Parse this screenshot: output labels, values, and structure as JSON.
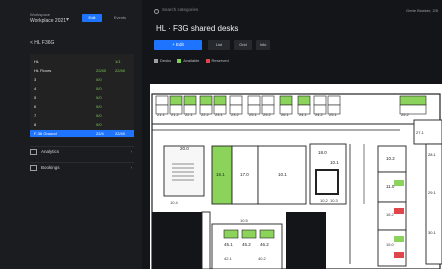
{
  "sidebar": {
    "title": "Workspace",
    "subtitle": "Workplace 2021",
    "tabs": [
      {
        "label": "Edit"
      },
      {
        "label": "Events"
      }
    ],
    "back": "< HL F36G",
    "rows": [
      {
        "name": "HL",
        "v1": "",
        "v2": "1/1"
      },
      {
        "name": "HL Floors",
        "v1": "22/40",
        "v2": "22/40"
      },
      {
        "name": "3",
        "v1": "0/0",
        "v2": ""
      },
      {
        "name": "4",
        "v1": "0/0",
        "v2": ""
      },
      {
        "name": "5",
        "v1": "0/0",
        "v2": ""
      },
      {
        "name": "6",
        "v1": "0/0",
        "v2": ""
      },
      {
        "name": "7",
        "v1": "0/0",
        "v2": ""
      },
      {
        "name": "8",
        "v1": "0/0",
        "v2": ""
      },
      {
        "name": "F-36 Ground",
        "v1": "22/4",
        "v2": "22/40",
        "selected": true
      }
    ],
    "sections": [
      {
        "label": "Analytics"
      },
      {
        "label": "Bookings"
      }
    ]
  },
  "main": {
    "search_placeholder": "Search categories",
    "user": "Grete Bowker, 2/5",
    "title": "HL · F3G shared desks",
    "primary_button": "+ Edit",
    "toolbar": [
      {
        "label": "List"
      },
      {
        "label": "Grid"
      },
      {
        "label": "Info"
      }
    ],
    "legend": [
      {
        "label": "Desks",
        "color": "#9aa0a6"
      },
      {
        "label": "Available",
        "color": "#7fcf57"
      },
      {
        "label": "Reserved",
        "color": "#e0454b"
      }
    ]
  },
  "floorplan": {
    "top_desks": [
      "21.1",
      "21.2",
      "22.1",
      "22.2",
      "23.1",
      "23.2",
      "25.1",
      "25.2",
      "26.1",
      "24.1",
      "24.2",
      "25.1",
      "25.2"
    ],
    "rooms": [
      "20.0",
      "15.1",
      "17.0",
      "10.1",
      "18.0",
      "10.1",
      "10.2",
      "11.0"
    ],
    "labels": [
      "16.2",
      "15.0",
      "10.2",
      "10.3",
      "10.4",
      "10.5",
      "42.1",
      "40.2"
    ],
    "bottom_desks": [
      "45.1",
      "45.2",
      "46.2"
    ],
    "right_desks": [
      "27.1",
      "28.1",
      "29.1",
      "30.1"
    ],
    "colors": {
      "available": "#8bd35a",
      "wall": "#222222",
      "room": "#f4f4f4"
    }
  }
}
